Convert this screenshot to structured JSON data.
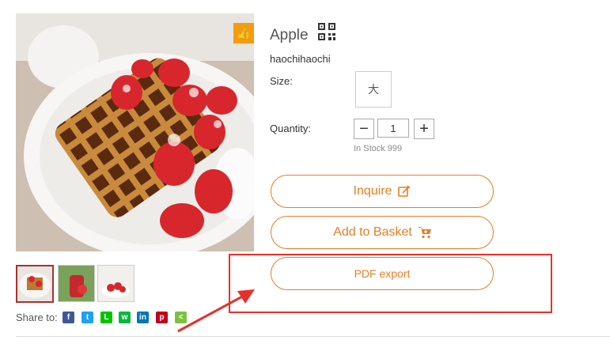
{
  "product": {
    "title": "Apple",
    "seller": "haochihaochi",
    "size_label": "Size:",
    "size_option": "大",
    "quantity_label": "Quantity:",
    "quantity_value": "1",
    "stock_text": "In Stock 999"
  },
  "actions": {
    "inquire_label": "Inquire",
    "add_to_basket_label": "Add to Basket",
    "pdf_export_label": "PDF export"
  },
  "share": {
    "label": "Share to:",
    "networks": [
      "facebook-icon",
      "twitter-icon",
      "line-icon",
      "wechat-icon",
      "linkedin-icon",
      "pinterest-icon",
      "share-icon"
    ]
  },
  "colors": {
    "accent": "#e67e22",
    "highlight": "#e8302a",
    "like_badge": "#f39c12"
  }
}
